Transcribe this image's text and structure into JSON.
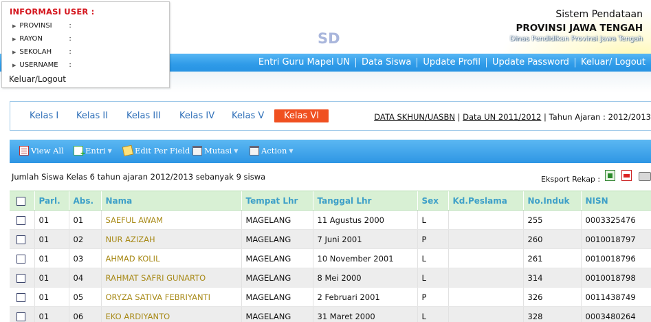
{
  "userbox": {
    "title": "INFORMASI USER :",
    "fields": [
      {
        "label": "PROVINSI",
        "sep": ":"
      },
      {
        "label": "RAYON",
        "sep": ":"
      },
      {
        "label": "SEKOLAH",
        "sep": ":"
      },
      {
        "label": "USERNAME",
        "sep": ":"
      }
    ],
    "logout": "Keluar/Logout"
  },
  "header": {
    "sd": "SD",
    "system": "Sistem Pendataan",
    "province": "PROVINSI JAWA TENGAH",
    "agency": "Dinas Pendidikan Provinsi Jawa Tengah"
  },
  "nav": [
    "Entri Guru Mapel UN",
    "Data Siswa",
    "Update Profil",
    "Update Password",
    "Keluar/ Logout"
  ],
  "kelas": {
    "tabs": [
      "Kelas I",
      "Kelas II",
      "Kelas III",
      "Kelas IV",
      "Kelas V",
      "Kelas VI"
    ],
    "active": "Kelas VI",
    "link1": "DATA SKHUN/UASBN",
    "sep": "|",
    "link2": "Data UN 2011/2012",
    "year": "| Tahun Ajaran : 2012/2013"
  },
  "toolbar": {
    "view_all": "View All",
    "entri": "Entri",
    "edit": "Edit Per Field",
    "mutasi": "Mutasi",
    "action": "Action"
  },
  "summary": "Jumlah Siswa Kelas 6 tahun ajaran 2012/2013 sebanyak 9 siswa",
  "export_label": "Eksport Rekap :",
  "table": {
    "columns": [
      "Parl.",
      "Abs.",
      "Nama",
      "Tempat Lhr",
      "Tanggal Lhr",
      "Sex",
      "Kd.Peslama",
      "No.Induk",
      "NISN"
    ],
    "rows": [
      [
        "01",
        "01",
        "SAEFUL AWAM",
        "MAGELANG",
        "11 Agustus 2000",
        "L",
        "",
        "255",
        "0003325476"
      ],
      [
        "01",
        "02",
        "NUR AZIZAH",
        "MAGELANG",
        "7 Juni 2001",
        "P",
        "",
        "260",
        "0010018797"
      ],
      [
        "01",
        "03",
        "AHMAD KOLIL",
        "MAGELANG",
        "10 November 2001",
        "L",
        "",
        "261",
        "0010018796"
      ],
      [
        "01",
        "04",
        "RAHMAT SAFRI GUNARTO",
        "MAGELANG",
        "8 Mei 2000",
        "L",
        "",
        "314",
        "0010018798"
      ],
      [
        "01",
        "05",
        "ORYZA SATIVA FEBRIYANTI",
        "MAGELANG",
        "2 Februari 2001",
        "P",
        "",
        "326",
        "0011438749"
      ],
      [
        "01",
        "06",
        "EKO ARDIYANTO",
        "MAGELANG",
        "31 Maret 2000",
        "L",
        "",
        "328",
        "0003480264"
      ]
    ]
  }
}
